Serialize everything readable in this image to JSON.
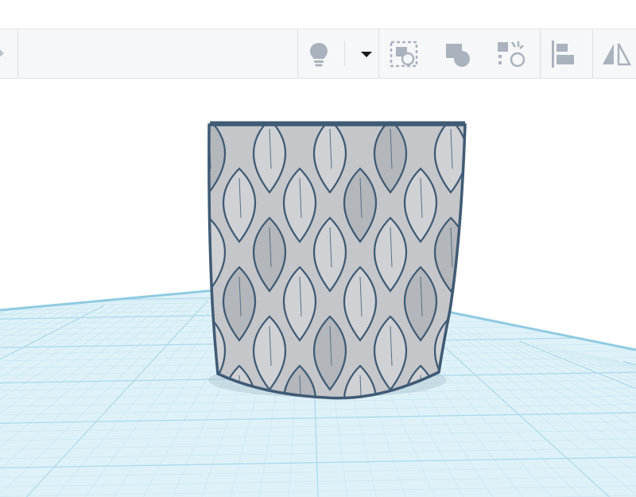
{
  "colors": {
    "background": "#ffffff",
    "toolbar": "#f6f7f9",
    "icon": "#a9b2bd",
    "workplane": "#dff1f8",
    "grid_minor": "#c9e6f1",
    "grid_major": "#a9d8ea",
    "workplane_edge": "#8fcbe2",
    "object_fill": "#c4c6c9",
    "object_outline": "#3f5a74"
  },
  "toolbar": {
    "tools": [
      {
        "icon": "lightbulb-icon"
      },
      {
        "icon": "dropdown-caret-icon"
      },
      {
        "icon": "group-icon"
      },
      {
        "icon": "union-icon"
      },
      {
        "icon": "ungroup-icon"
      },
      {
        "icon": "align-icon"
      },
      {
        "icon": "mirror-icon"
      }
    ]
  },
  "scene": {
    "object": "dragon-scale-cylinder"
  }
}
